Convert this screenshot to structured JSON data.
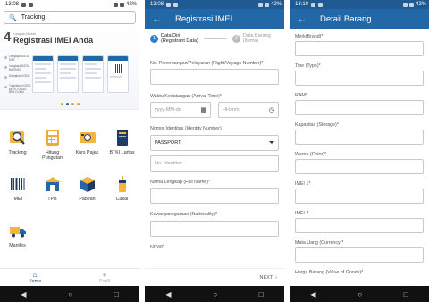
{
  "status": {
    "p1_time": "13:08",
    "p2_time": "13:08",
    "p3_time": "13:10",
    "battery": "42%"
  },
  "home": {
    "search_value": "Tracking",
    "banner": {
      "number": "4",
      "subtitle": "Langkah Mudah",
      "title": "Registrasi IMEI Anda",
      "steps": [
        "Lengkapi DATA DIRI",
        "Lengkapi DATA BARANG",
        "Dapatkan KODE",
        "Tunjukkan KODE ke PETUGAS BEA CUKAI"
      ]
    },
    "menu": [
      {
        "label": "Tracking",
        "icon": "tracking-icon"
      },
      {
        "label": "Hitung Pungutan",
        "icon": "calculator-icon"
      },
      {
        "label": "Kurs Pajak",
        "icon": "currency-icon"
      },
      {
        "label": "BTKI Lartas",
        "icon": "book-icon"
      },
      {
        "label": "IMEI",
        "icon": "barcode-icon"
      },
      {
        "label": "TPB",
        "icon": "warehouse-icon"
      },
      {
        "label": "Pabean",
        "icon": "box-icon"
      },
      {
        "label": "Cukai",
        "icon": "tobacco-icon"
      },
      {
        "label": "Manifes",
        "icon": "truck-icon"
      }
    ],
    "nav": [
      {
        "label": "Home",
        "icon": "home-icon"
      },
      {
        "label": "Profil",
        "icon": "user-icon"
      }
    ]
  },
  "registrasi": {
    "title": "Registrasi IMEI",
    "steps": [
      {
        "num": "1",
        "line1": "Data Diri",
        "line2": "(Registrant Data)"
      },
      {
        "num": "2",
        "line1": "Data Barang",
        "line2": "(Items)"
      }
    ],
    "fields": {
      "flight_label": "No. Penerbangan/Pelayaran (Flight/Voyage Number)*",
      "arrival_label": "Waktu Kedatangan (Arrival Time)*",
      "date_placeholder": "yyyy-MM-dd",
      "time_placeholder": "HH:mm",
      "id_label": "Nomor Identitas (Identity Number)",
      "id_type": "PASSPORT",
      "id_placeholder": "No. Identitas",
      "name_label": "Nama Lengkap (Full Name)*",
      "nationality_label": "Kewarganegaraan (Nationality)*",
      "npwp_label": "NPWP"
    },
    "next_label": "NEXT"
  },
  "detail": {
    "title": "Detail Barang",
    "labels": [
      "Merk(Brand)*",
      "Tipe (Type)*",
      "RAM*",
      "Kapasitas (Storage)*",
      "Warna (Color)*",
      "IMEI 1*",
      "IMEI 2",
      "Mata Uang (Currency)*",
      "Harga Barang (Value of Goods)*"
    ]
  },
  "colors": {
    "appbar": "#2368a6",
    "statusbar": "#1f5a93",
    "accent": "#2f7dd1"
  }
}
